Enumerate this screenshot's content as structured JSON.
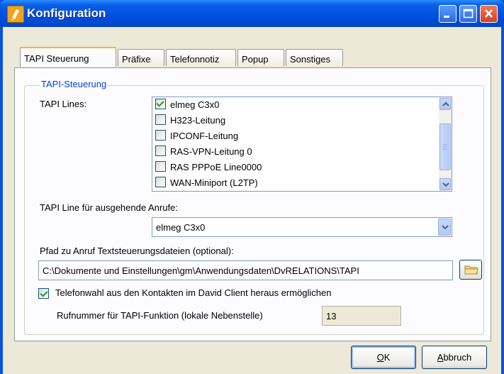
{
  "window": {
    "title": "Konfiguration",
    "icon": "app-icon"
  },
  "tabs": [
    {
      "label": "TAPI Steuerung",
      "active": true
    },
    {
      "label": "Präfixe"
    },
    {
      "label": "Telefonnotiz"
    },
    {
      "label": "Popup"
    },
    {
      "label": "Sonstiges"
    }
  ],
  "group": {
    "legend": "TAPI-Steuerung"
  },
  "tapi_lines": {
    "label": "TAPI Lines:",
    "items": [
      {
        "label": "elmeg C3x0",
        "checked": true
      },
      {
        "label": "H323-Leitung",
        "checked": false
      },
      {
        "label": "IPCONF-Leitung",
        "checked": false
      },
      {
        "label": "RAS-VPN-Leitung 0",
        "checked": false
      },
      {
        "label": "RAS PPPoE Line0000",
        "checked": false
      },
      {
        "label": "WAN-Miniport (L2TP)",
        "checked": false
      }
    ]
  },
  "outgoing": {
    "label": "TAPI Line für ausgehende Anrufe:",
    "value": "elmeg C3x0"
  },
  "path": {
    "label": "Pfad zu Anruf Textsteuerungsdateien (optional):",
    "value": "C:\\Dokumente und Einstellungen\\gm\\Anwendungsdaten\\DvRELATIONS\\TAPI"
  },
  "dial_option": {
    "label": "Telefonwahl aus den Kontakten im David Client heraus ermöglichen",
    "checked": true
  },
  "extension": {
    "label": "Rufnummer für TAPI-Funktion (lokale Nebenstelle)",
    "value": "13"
  },
  "buttons": {
    "ok_mnemonic": "O",
    "ok_rest": "K",
    "cancel_mnemonic": "A",
    "cancel_rest": "bbruch"
  },
  "colors": {
    "title_bar": "#0054e3",
    "group_legend": "#0046d5",
    "tab_highlight": "#f6b33a"
  }
}
